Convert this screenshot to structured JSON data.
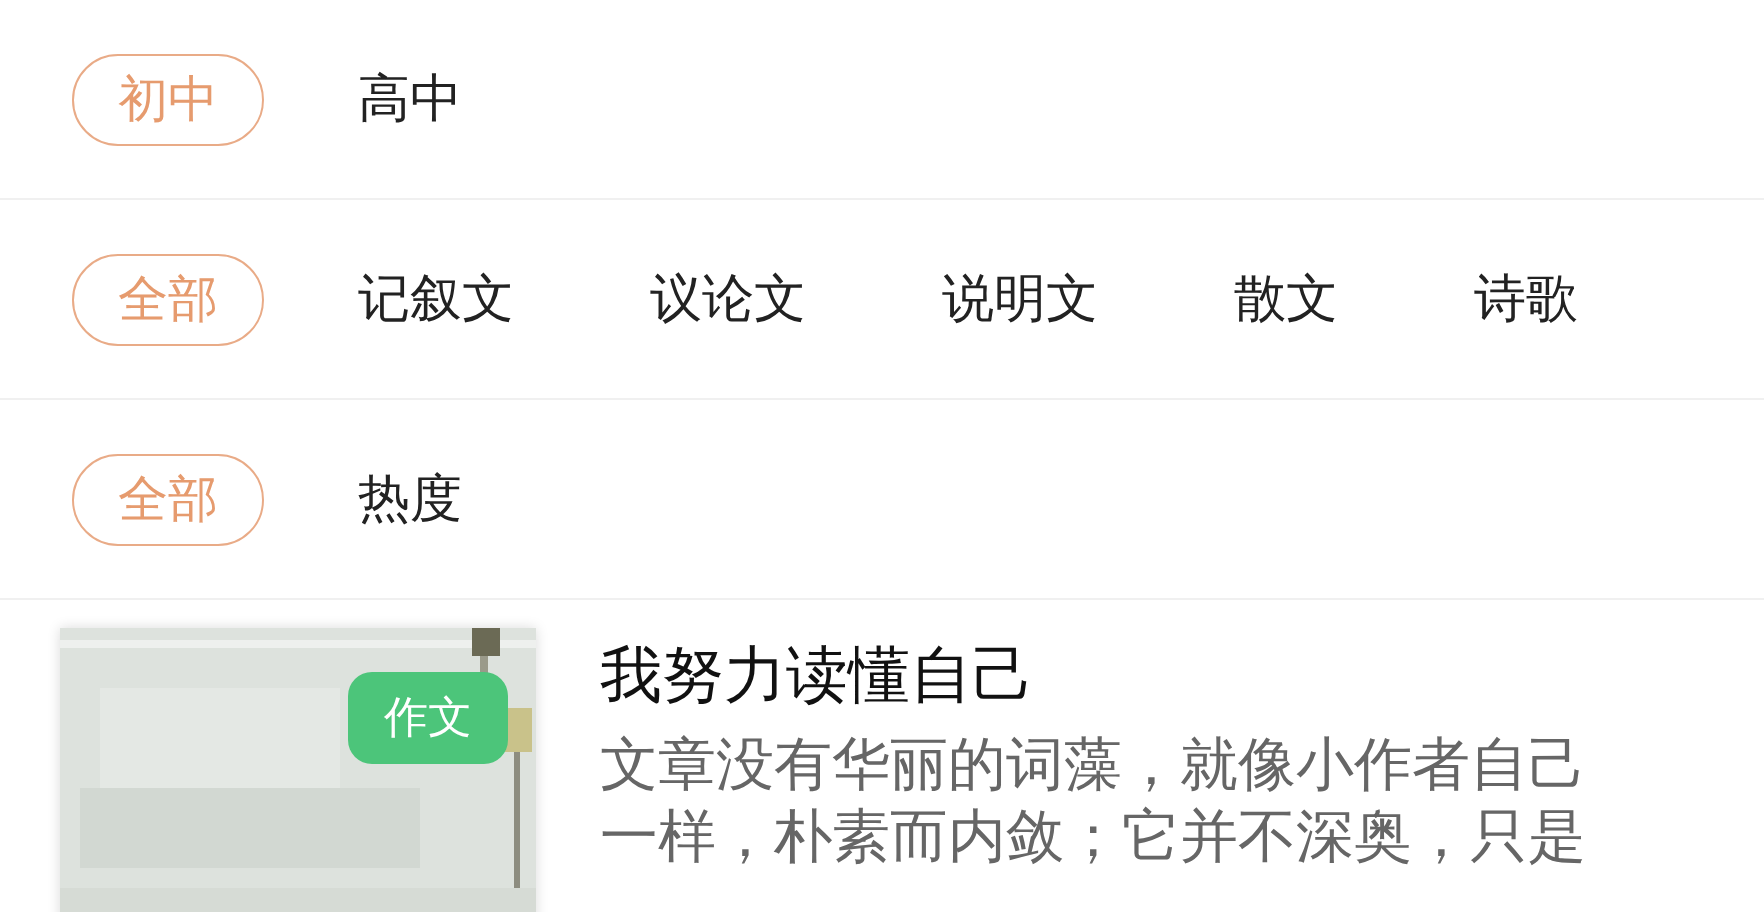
{
  "filters": [
    {
      "options": [
        {
          "label": "初中",
          "selected": true
        },
        {
          "label": "高中",
          "selected": false
        }
      ]
    },
    {
      "options": [
        {
          "label": "全部",
          "selected": true
        },
        {
          "label": "记叙文",
          "selected": false
        },
        {
          "label": "议论文",
          "selected": false
        },
        {
          "label": "说明文",
          "selected": false
        },
        {
          "label": "散文",
          "selected": false
        },
        {
          "label": "诗歌",
          "selected": false
        }
      ]
    },
    {
      "options": [
        {
          "label": "全部",
          "selected": true
        },
        {
          "label": "热度",
          "selected": false
        }
      ]
    }
  ],
  "articles": [
    {
      "badge": "作文",
      "title": "我努力读懂自己",
      "summary": "文章没有华丽的词藻，就像小作者自己一样，朴素而内敛；它并不深奥，只是"
    }
  ]
}
